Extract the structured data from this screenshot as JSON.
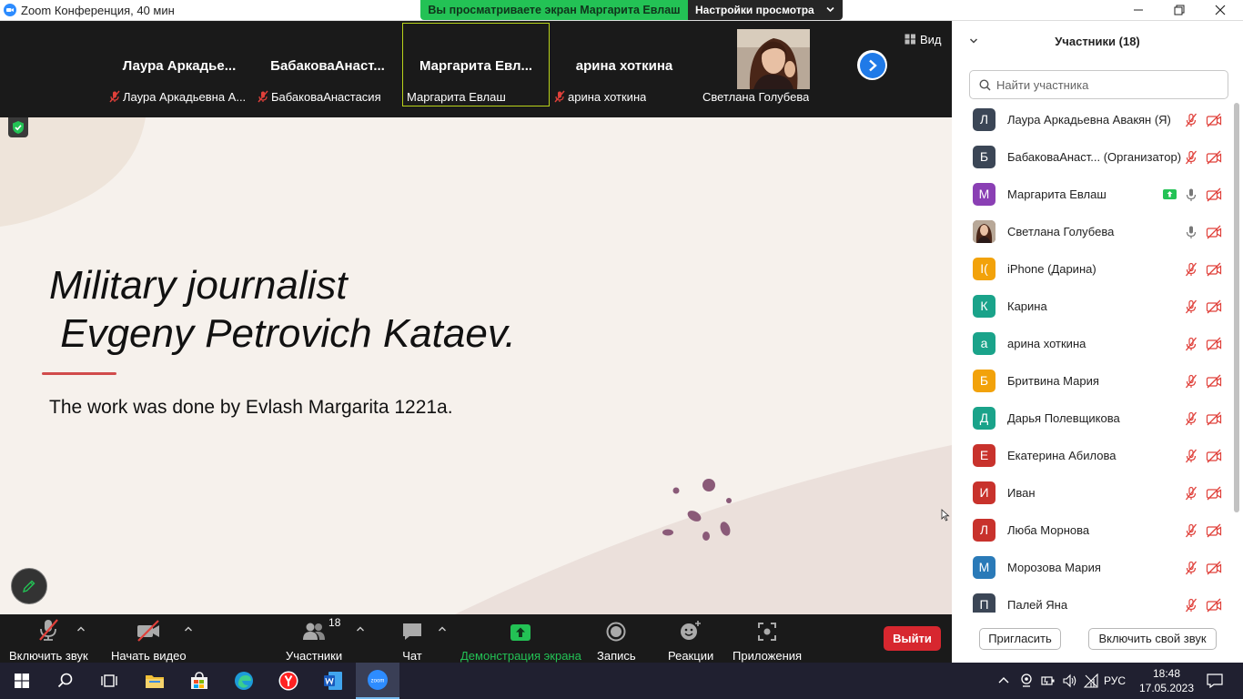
{
  "window": {
    "title": "Zoom Конференция, 40 мин"
  },
  "share_banner": {
    "text": "Вы просматриваете экран Маргарита Евлаш",
    "settings_label": "Настройки просмотра"
  },
  "video_strip": {
    "tiles": [
      {
        "name": "Лаура  Аркадье...",
        "label": "Лаура Аркадьевна А...",
        "muted": true
      },
      {
        "name": "БабаковаАнаст...",
        "label": "БабаковаАнастасия",
        "muted": true
      },
      {
        "name": "Маргарита  Евл...",
        "label": "Маргарита Евлаш",
        "muted": false
      },
      {
        "name": "арина хоткина",
        "label": "арина хоткина",
        "muted": true
      },
      {
        "name": "",
        "label": "Светлана Голубева",
        "muted": false
      }
    ],
    "view_label": "Вид"
  },
  "slide": {
    "title": "Military journalist\n Evgeny Petrovich Kataev.",
    "subtitle": "The work was done by Evlash Margarita 1221a."
  },
  "toolbar": {
    "audio_label": "Включить звук",
    "video_label": "Начать видео",
    "participants_label": "Участники",
    "participants_count": "18",
    "chat_label": "Чат",
    "share_label": "Демонстрация экрана",
    "record_label": "Запись",
    "reactions_label": "Реакции",
    "apps_label": "Приложения",
    "leave_label": "Выйти"
  },
  "participants_panel": {
    "title": "Участники (18)",
    "search_placeholder": "Найти участника",
    "participants": [
      {
        "initial": "Л",
        "name": "Лаура Аркадьевна Авакян (Я)",
        "color": "#3b4656",
        "mic": "muted",
        "sharing": false
      },
      {
        "initial": "Б",
        "name": "БабаковаАнаст...  (Организатор)",
        "color": "#3b4656",
        "mic": "muted",
        "sharing": false
      },
      {
        "initial": "М",
        "name": "Маргарита Евлаш",
        "color": "#8a3fb4",
        "mic": "on",
        "sharing": true
      },
      {
        "initial": "",
        "name": "Светлана Голубева",
        "color": "#6b4a3a",
        "mic": "on",
        "sharing": false
      },
      {
        "initial": "I(",
        "name": "iPhone (Дарина)",
        "color": "#f2a20a",
        "mic": "muted",
        "sharing": false
      },
      {
        "initial": "К",
        "name": "Карина",
        "color": "#1aa38a",
        "mic": "muted",
        "sharing": false
      },
      {
        "initial": "а",
        "name": "арина хоткина",
        "color": "#1aa38a",
        "mic": "muted",
        "sharing": false
      },
      {
        "initial": "Б",
        "name": "Бритвина Мария",
        "color": "#f2a20a",
        "mic": "muted",
        "sharing": false
      },
      {
        "initial": "Д",
        "name": "Дарья Полевщикова",
        "color": "#1aa38a",
        "mic": "muted",
        "sharing": false
      },
      {
        "initial": "Е",
        "name": "Екатерина Абилова",
        "color": "#c8322c",
        "mic": "muted",
        "sharing": false
      },
      {
        "initial": "И",
        "name": "Иван",
        "color": "#c8322c",
        "mic": "muted",
        "sharing": false
      },
      {
        "initial": "Л",
        "name": "Люба Морнова",
        "color": "#c8322c",
        "mic": "muted",
        "sharing": false
      },
      {
        "initial": "М",
        "name": "Морозова Мария",
        "color": "#2a7ab8",
        "mic": "muted",
        "sharing": false
      },
      {
        "initial": "П",
        "name": "Палей Яна",
        "color": "#3b4656",
        "mic": "muted",
        "sharing": false
      }
    ],
    "invite_label": "Пригласить",
    "unmute_label": "Включить свой звук"
  },
  "taskbar": {
    "language": "РУС",
    "time": "18:48",
    "date": "17.05.2023"
  },
  "colors": {
    "share_green": "#23c255",
    "leave_red": "#d7272f",
    "accent_blue": "#1f7ae8",
    "muted_red": "#e0403a"
  }
}
